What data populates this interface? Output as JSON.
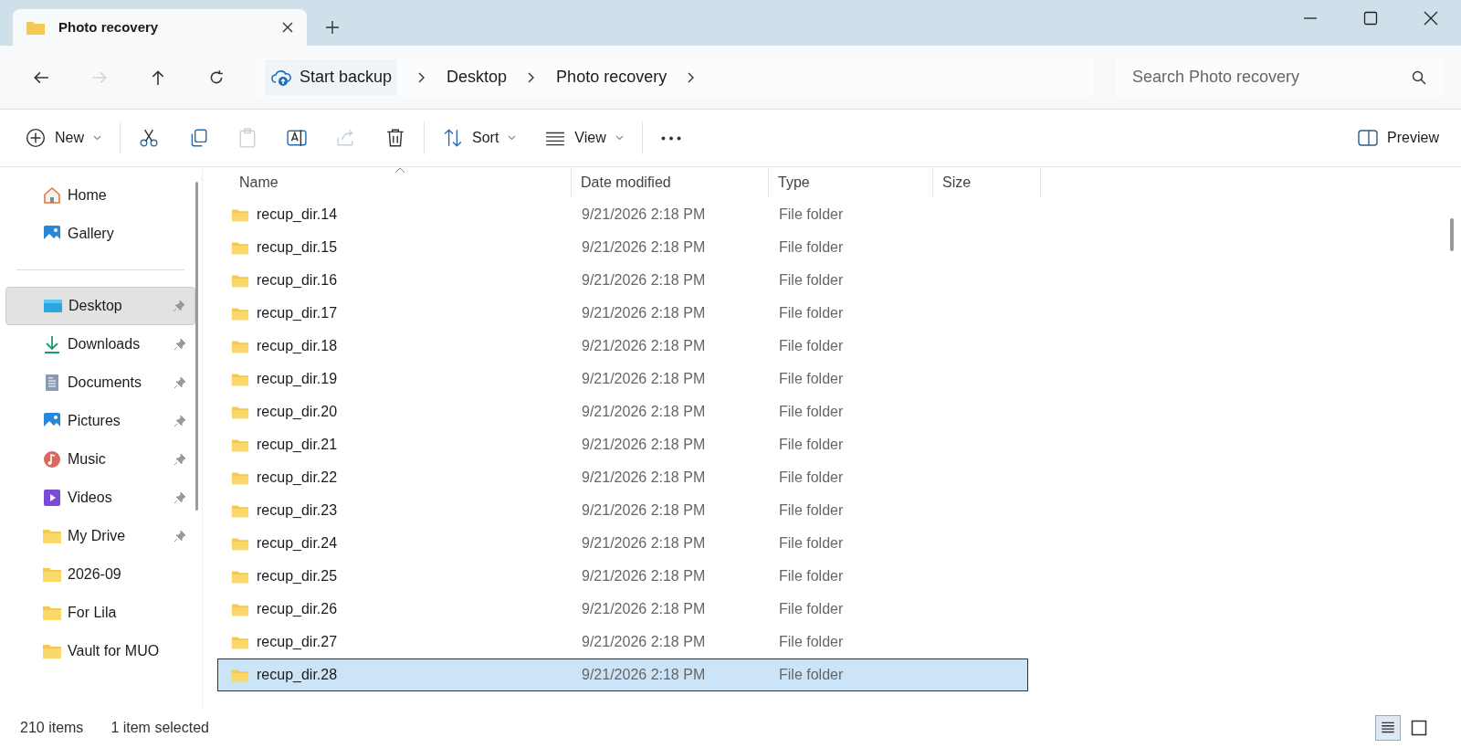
{
  "window": {
    "tab_title": "Photo recovery"
  },
  "nav_buttons": [
    {
      "kind": "back",
      "disabled": false
    },
    {
      "kind": "forward",
      "disabled": true
    },
    {
      "kind": "up",
      "disabled": false
    },
    {
      "kind": "refresh",
      "disabled": false
    }
  ],
  "address_bar": {
    "backup_label": "Start backup",
    "crumbs": [
      "Desktop",
      "Photo recovery"
    ]
  },
  "search": {
    "placeholder": "Search Photo recovery"
  },
  "toolbar": [
    {
      "kind": "new",
      "label": "New",
      "disabled": false
    },
    {
      "kind": "cut",
      "disabled": false
    },
    {
      "kind": "copy",
      "disabled": false
    },
    {
      "kind": "paste",
      "disabled": true
    },
    {
      "kind": "rename",
      "disabled": false
    },
    {
      "kind": "share",
      "disabled": true
    },
    {
      "kind": "delete",
      "disabled": false
    },
    {
      "kind": "sort",
      "label": "Sort",
      "disabled": false
    },
    {
      "kind": "view",
      "label": "View",
      "disabled": false
    },
    {
      "kind": "more",
      "disabled": false
    }
  ],
  "preview_button": {
    "label": "Preview"
  },
  "sidebar": {
    "top": [
      {
        "kind": "home",
        "label": "Home",
        "selected": false
      },
      {
        "kind": "gallery",
        "label": "Gallery",
        "selected": false
      }
    ],
    "places": [
      {
        "kind": "desktop",
        "label": "Desktop",
        "pinned": true,
        "selected": true
      },
      {
        "kind": "downloads",
        "label": "Downloads",
        "pinned": true,
        "selected": false
      },
      {
        "kind": "documents",
        "label": "Documents",
        "pinned": true,
        "selected": false
      },
      {
        "kind": "pictures",
        "label": "Pictures",
        "pinned": true,
        "selected": false
      },
      {
        "kind": "music",
        "label": "Music",
        "pinned": true,
        "selected": false
      },
      {
        "kind": "videos",
        "label": "Videos",
        "pinned": true,
        "selected": false
      },
      {
        "kind": "folder",
        "label": "My Drive",
        "pinned": true,
        "selected": false
      },
      {
        "kind": "folder",
        "label": "2026-09",
        "pinned": false,
        "selected": false
      },
      {
        "kind": "folder",
        "label": "For Lila",
        "pinned": false,
        "selected": false
      },
      {
        "kind": "folder",
        "label": "Vault for MUO",
        "pinned": false,
        "selected": false
      }
    ]
  },
  "table": {
    "columns": [
      "Name",
      "Date modified",
      "Type",
      "Size"
    ],
    "rows": [
      {
        "name": "recup_dir.14",
        "date": "9/21/2026 2:18 PM",
        "type": "File folder",
        "selected": false
      },
      {
        "name": "recup_dir.15",
        "date": "9/21/2026 2:18 PM",
        "type": "File folder",
        "selected": false
      },
      {
        "name": "recup_dir.16",
        "date": "9/21/2026 2:18 PM",
        "type": "File folder",
        "selected": false
      },
      {
        "name": "recup_dir.17",
        "date": "9/21/2026 2:18 PM",
        "type": "File folder",
        "selected": false
      },
      {
        "name": "recup_dir.18",
        "date": "9/21/2026 2:18 PM",
        "type": "File folder",
        "selected": false
      },
      {
        "name": "recup_dir.19",
        "date": "9/21/2026 2:18 PM",
        "type": "File folder",
        "selected": false
      },
      {
        "name": "recup_dir.20",
        "date": "9/21/2026 2:18 PM",
        "type": "File folder",
        "selected": false
      },
      {
        "name": "recup_dir.21",
        "date": "9/21/2026 2:18 PM",
        "type": "File folder",
        "selected": false
      },
      {
        "name": "recup_dir.22",
        "date": "9/21/2026 2:18 PM",
        "type": "File folder",
        "selected": false
      },
      {
        "name": "recup_dir.23",
        "date": "9/21/2026 2:18 PM",
        "type": "File folder",
        "selected": false
      },
      {
        "name": "recup_dir.24",
        "date": "9/21/2026 2:18 PM",
        "type": "File folder",
        "selected": false
      },
      {
        "name": "recup_dir.25",
        "date": "9/21/2026 2:18 PM",
        "type": "File folder",
        "selected": false
      },
      {
        "name": "recup_dir.26",
        "date": "9/21/2026 2:18 PM",
        "type": "File folder",
        "selected": false
      },
      {
        "name": "recup_dir.27",
        "date": "9/21/2026 2:18 PM",
        "type": "File folder",
        "selected": false
      },
      {
        "name": "recup_dir.28",
        "date": "9/21/2026 2:18 PM",
        "type": "File folder",
        "selected": true
      }
    ]
  },
  "status_bar": {
    "item_count": "210 items",
    "selection": "1 item selected"
  }
}
